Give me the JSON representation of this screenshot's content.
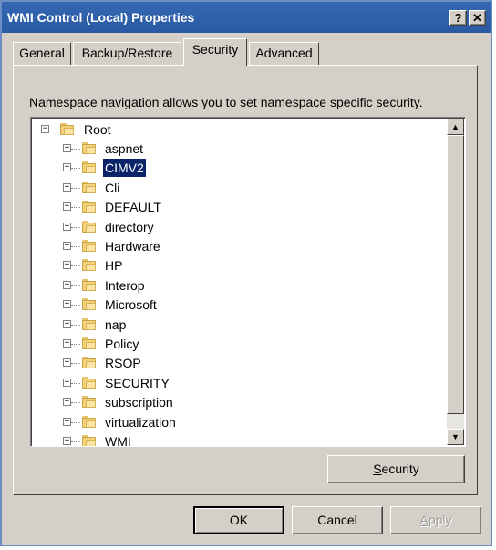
{
  "window": {
    "title": "WMI Control (Local) Properties",
    "help_label": "?",
    "close_label": "✕"
  },
  "tabs": [
    {
      "label": "General",
      "active": false
    },
    {
      "label": "Backup/Restore",
      "active": false
    },
    {
      "label": "Security",
      "active": true
    },
    {
      "label": "Advanced",
      "active": false
    }
  ],
  "security_tab": {
    "description": "Namespace navigation allows you to set namespace specific security.",
    "tree": {
      "root": {
        "label": "Root",
        "expander": "−"
      },
      "children": [
        {
          "label": "aspnet",
          "selected": false
        },
        {
          "label": "CIMV2",
          "selected": true
        },
        {
          "label": "Cli",
          "selected": false
        },
        {
          "label": "DEFAULT",
          "selected": false
        },
        {
          "label": "directory",
          "selected": false
        },
        {
          "label": "Hardware",
          "selected": false
        },
        {
          "label": "HP",
          "selected": false
        },
        {
          "label": "Interop",
          "selected": false
        },
        {
          "label": "Microsoft",
          "selected": false
        },
        {
          "label": "nap",
          "selected": false
        },
        {
          "label": "Policy",
          "selected": false
        },
        {
          "label": "RSOP",
          "selected": false
        },
        {
          "label": "SECURITY",
          "selected": false
        },
        {
          "label": "subscription",
          "selected": false
        },
        {
          "label": "virtualization",
          "selected": false
        },
        {
          "label": "WMI",
          "selected": false
        }
      ],
      "child_expander": "+"
    },
    "security_button": {
      "mnemonic": "S",
      "rest": "ecurity"
    }
  },
  "footer": {
    "ok_label": "OK",
    "cancel_label": "Cancel",
    "apply_label": {
      "mnemonic": "A",
      "rest": "pply"
    }
  },
  "scrollbar": {
    "up": "▲",
    "down": "▼"
  }
}
